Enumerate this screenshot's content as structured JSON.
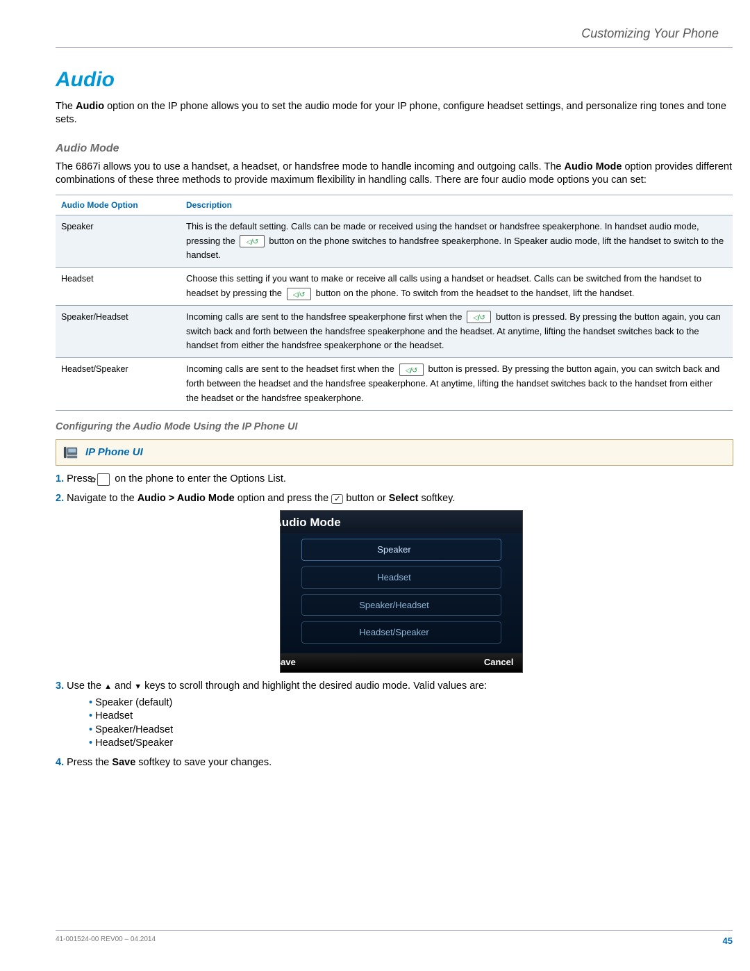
{
  "header": {
    "section": "Customizing Your Phone"
  },
  "h1": "Audio",
  "intro_before": "The ",
  "intro_bold": "Audio",
  "intro_after": " option on the IP phone allows you to set the audio mode for your IP phone, configure headset settings, and personalize ring tones and tone sets.",
  "h2": "Audio Mode",
  "am_before": "The 6867i allows you to use a handset, a headset, or handsfree mode to handle incoming and outgoing calls. The ",
  "am_bold": "Audio Mode",
  "am_after": " option provides different combinations of these three methods to provide maximum flexibility in handling calls. There are four audio mode options you can set:",
  "table": {
    "col1": "Audio Mode Option",
    "col2": "Description",
    "rows": [
      {
        "opt": "Speaker",
        "d1": "This is the default setting. Calls can be made or received using the handset or handsfree speakerphone. In handset audio mode, pressing the ",
        "d2": " button on the phone switches to handsfree speakerphone. In Speaker audio mode, lift the handset to switch to the handset."
      },
      {
        "opt": "Headset",
        "d1": "Choose this setting if you want to make or receive all calls using a handset or headset. Calls can be switched from the handset to headset by pressing the ",
        "d2": " button on the phone. To switch from the headset to the handset, lift the handset."
      },
      {
        "opt": "Speaker/Headset",
        "d1": "Incoming calls are sent to the handsfree speakerphone first when the ",
        "d2": " button is pressed. By pressing the button again, you can switch back and forth between the handsfree speakerphone and the headset. At anytime, lifting the handset switches back to the handset from either the handsfree speakerphone or the headset."
      },
      {
        "opt": "Headset/Speaker",
        "d1": "Incoming calls are sent to the headset first when the ",
        "d2": " button is pressed. By pressing the button again, you can switch back and forth between the headset and the handsfree speakerphone. At anytime, lifting the handset switches back to the handset from either the headset or the handsfree speakerphone."
      }
    ]
  },
  "h3": "Configuring the Audio Mode Using the IP Phone UI",
  "uibox": "IP Phone UI",
  "steps": {
    "s1a": "Press ",
    "s1b": " on the phone to enter the Options List.",
    "s2a": "Navigate to the ",
    "s2b": "Audio > Audio Mode",
    "s2c": " option and press the ",
    "s2d": " button or ",
    "s2e": "Select",
    "s2f": " softkey.",
    "s3a": "Use the ",
    "s3b": " and ",
    "s3c": " keys to scroll through and highlight the desired audio mode. Valid values are:",
    "s3opts": [
      "Speaker (default)",
      "Headset",
      "Speaker/Headset",
      "Headset/Speaker"
    ],
    "s4a": "Press the ",
    "s4b": "Save",
    "s4c": " softkey to save your changes."
  },
  "screen": {
    "title": "Audio Mode",
    "opts": [
      "Speaker",
      "Headset",
      "Speaker/Headset",
      "Headset/Speaker"
    ],
    "save": "Save",
    "cancel": "Cancel"
  },
  "footer": {
    "doc": "41-001524-00 REV00 – 04.2014",
    "page": "45"
  }
}
